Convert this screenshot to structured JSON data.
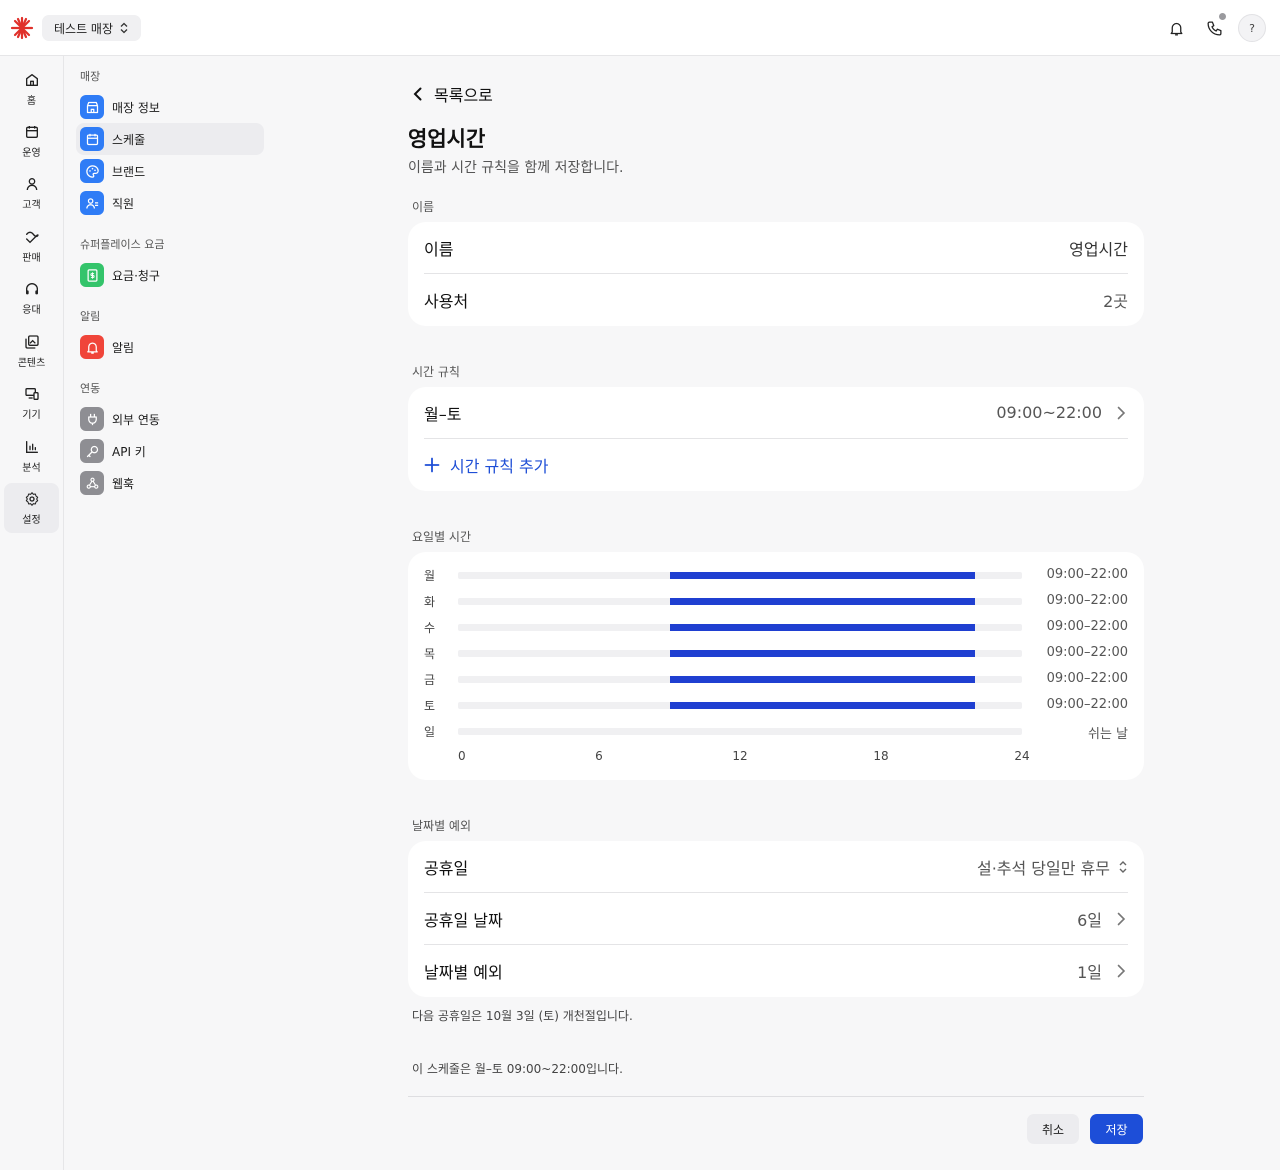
{
  "topbar": {
    "store_name": "테스트 매장",
    "help_label": "?"
  },
  "rail": [
    {
      "label": "홈",
      "icon": "home-icon"
    },
    {
      "label": "운영",
      "icon": "calendar-icon"
    },
    {
      "label": "고객",
      "icon": "person-icon"
    },
    {
      "label": "판매",
      "icon": "sales-icon"
    },
    {
      "label": "응대",
      "icon": "headset-icon"
    },
    {
      "label": "콘텐츠",
      "icon": "gallery-icon"
    },
    {
      "label": "기기",
      "icon": "devices-icon"
    },
    {
      "label": "분석",
      "icon": "chart-icon"
    },
    {
      "label": "설정",
      "icon": "gear-icon"
    }
  ],
  "menu": {
    "sections": [
      {
        "title": "매장",
        "items": [
          {
            "label": "매장 정보",
            "icon": "store-icon",
            "color": "#2f7cf6"
          },
          {
            "label": "스케줄",
            "icon": "calendar-icon",
            "color": "#2f7cf6"
          },
          {
            "label": "브랜드",
            "icon": "palette-icon",
            "color": "#2f7cf6"
          },
          {
            "label": "직원",
            "icon": "staff-icon",
            "color": "#2f7cf6"
          }
        ]
      },
      {
        "title": "슈퍼플레이스 요금",
        "items": [
          {
            "label": "요금·청구",
            "icon": "billing-icon",
            "color": "#34c46b"
          }
        ]
      },
      {
        "title": "알림",
        "items": [
          {
            "label": "알림",
            "icon": "bell-icon",
            "color": "#f0453a"
          }
        ]
      },
      {
        "title": "연동",
        "items": [
          {
            "label": "외부 연동",
            "icon": "plug-icon",
            "color": "#8e8e93"
          },
          {
            "label": "API 키",
            "icon": "key-icon",
            "color": "#8e8e93"
          },
          {
            "label": "웹훅",
            "icon": "webhook-icon",
            "color": "#8e8e93"
          }
        ]
      }
    ]
  },
  "main": {
    "back_label": "목록으로",
    "title": "영업시간",
    "subtitle": "이름과 시간 규칙을 함께 저장합니다.",
    "name_section": {
      "label": "이름",
      "rows": [
        {
          "label": "이름",
          "value": "영업시간"
        },
        {
          "label": "사용처",
          "value": "2곳"
        }
      ]
    },
    "rules_section": {
      "label": "시간 규칙",
      "rule": {
        "label": "월–토",
        "value": "09:00~22:00"
      },
      "add_label": "시간 규칙 추가"
    },
    "weekly_section": {
      "label": "요일별 시간"
    },
    "exceptions_section": {
      "label": "날짜별 예외",
      "rows": [
        {
          "label": "공휴일",
          "value": "설·추석 당일만 휴무"
        },
        {
          "label": "공휴일 날짜",
          "value": "6일"
        },
        {
          "label": "날짜별 예외",
          "value": "1일"
        }
      ],
      "note": "다음 공휴일은 10월 3일 (토) 개천절입니다."
    },
    "summary": "이 스케줄은 월–토 09:00~22:00입니다.",
    "cancel_label": "취소",
    "save_label": "저장"
  },
  "chart_data": {
    "type": "bar",
    "orientation": "horizontal-range",
    "categories": [
      "월",
      "화",
      "수",
      "목",
      "금",
      "토",
      "일"
    ],
    "ranges": [
      [
        9,
        22
      ],
      [
        9,
        22
      ],
      [
        9,
        22
      ],
      [
        9,
        22
      ],
      [
        9,
        22
      ],
      [
        9,
        22
      ],
      null
    ],
    "range_labels": [
      "09:00–22:00",
      "09:00–22:00",
      "09:00–22:00",
      "09:00–22:00",
      "09:00–22:00",
      "09:00–22:00",
      "쉬는 날"
    ],
    "xlim": [
      0,
      24
    ],
    "xticks": [
      "0",
      "6",
      "12",
      "18",
      "24"
    ],
    "bar_color": "#1f3fd1"
  }
}
